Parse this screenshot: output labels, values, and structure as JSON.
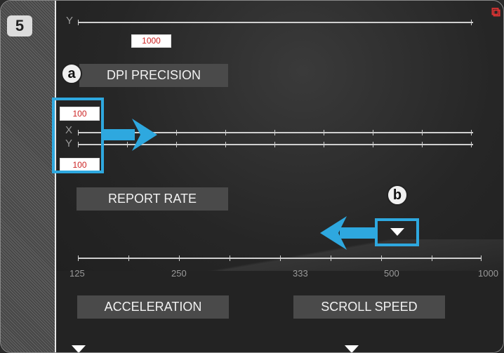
{
  "step": "5",
  "corner": "⧉",
  "dpi": {
    "title": "DPI PRECISION",
    "badge": "a",
    "top_y_value": "1000",
    "x_value": "100",
    "y_value": "100",
    "axis_x": "X",
    "axis_y": "Y"
  },
  "report_rate": {
    "title": "REPORT RATE",
    "badge": "b",
    "labels": [
      "125",
      "250",
      "333",
      "500",
      "1000"
    ]
  },
  "acceleration": {
    "title": "ACCELERATION"
  },
  "scroll_speed": {
    "title": "SCROLL SPEED"
  },
  "colors": {
    "highlight": "#2ea8df",
    "value_text": "#cc2222"
  }
}
